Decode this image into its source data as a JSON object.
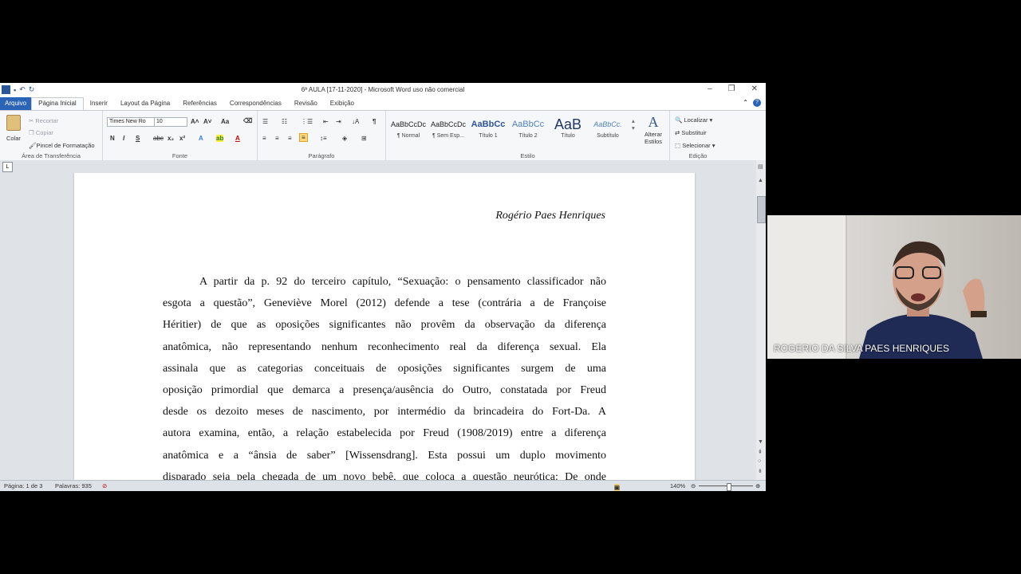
{
  "window": {
    "title": "6ª AULA [17-11-2020] - Microsoft Word uso não comercial",
    "qat_icons": [
      "word-icon",
      "save-icon",
      "undo-icon",
      "redo-icon"
    ]
  },
  "tabs": [
    "Arquivo",
    "Página Inicial",
    "Inserir",
    "Layout da Página",
    "Referências",
    "Correspondências",
    "Revisão",
    "Exibição"
  ],
  "ribbon": {
    "clipboard": {
      "paste": "Colar",
      "cut": "Recortar",
      "copy": "Copiar",
      "format_painter": "Pincel de Formatação",
      "label": "Área de Transferência"
    },
    "font": {
      "name": "Times New Ro",
      "size": "10",
      "label": "Fonte"
    },
    "paragraph": {
      "label": "Parágrafo"
    },
    "styles": {
      "items": [
        {
          "preview": "AaBbCcDc",
          "name": "¶ Normal"
        },
        {
          "preview": "AaBbCcDc",
          "name": "¶ Sem Esp..."
        },
        {
          "preview": "AaBbCc",
          "name": "Título 1"
        },
        {
          "preview": "AaBbCc",
          "name": "Título 2"
        },
        {
          "preview": "AaB",
          "name": "Título"
        },
        {
          "preview": "AaBbCc.",
          "name": "Subtítulo"
        }
      ],
      "change": "Alterar Estilos",
      "label": "Estilo"
    },
    "editing": {
      "find": "Localizar",
      "replace": "Substituir",
      "select": "Selecionar",
      "label": "Edição"
    }
  },
  "document": {
    "author": "Rogério Paes Henriques",
    "lines": [
      "A partir da p. 92 do terceiro capítulo, “Sexuação: o pensamento classificador não",
      "esgota a questão”, Geneviève Morel (2012) defende a tese (contrária a de Françoise",
      "Héritier) de que as oposições significantes não provêm da observação da diferença",
      "anatômica, não representando nenhum reconhecimento real da diferença sexual. Ela",
      "assinala que as categorias conceituais de oposições significantes surgem de uma",
      "oposição primordial que demarca a presença/ausência do Outro, constatada por Freud",
      "desde os dezoito meses de nascimento, por intermédio da brincadeira do Fort-Da. A",
      "autora examina, então, a relação estabelecida por Freud (1908/2019) entre a diferença",
      "anatômica e a “ânsia de saber” [Wissensdrang]. Esta possui um duplo movimento",
      "disparado seja pela chegada de um novo bebê, que coloca a questão neurótica: De onde"
    ]
  },
  "status": {
    "page": "Página: 1 de 3",
    "words": "Palavras: 935",
    "zoom": "140%"
  },
  "camera": {
    "name": "ROGERIO DA SILVA PAES HENRIQUES"
  }
}
